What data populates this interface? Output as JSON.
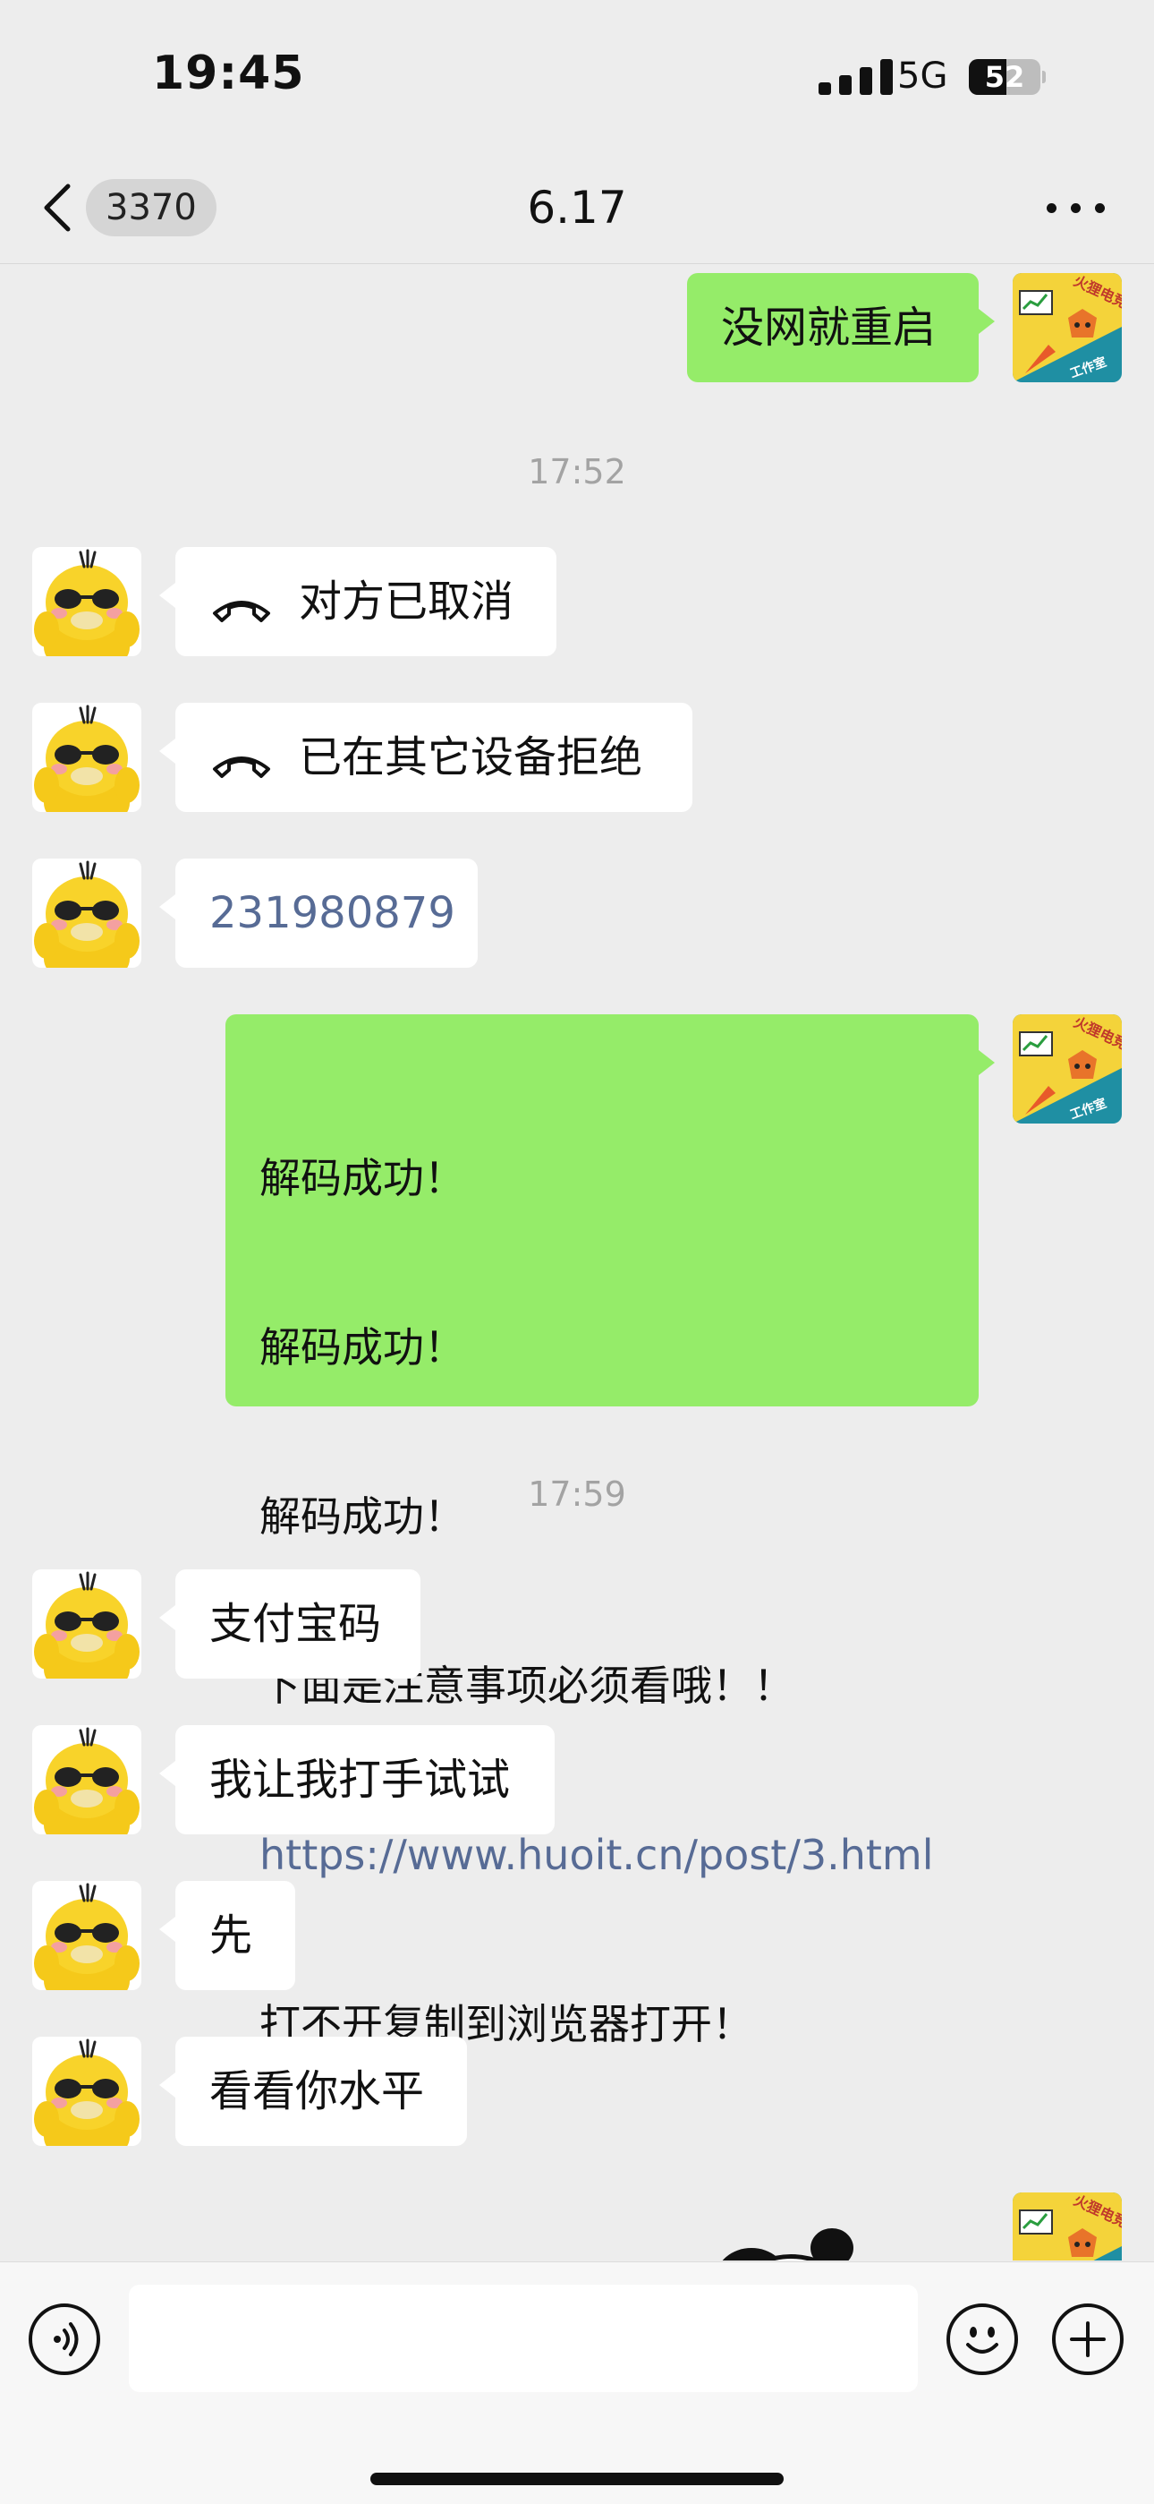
{
  "status_bar": {
    "time": "19:45",
    "network": "5G",
    "battery_level": "52",
    "battery_fraction": 0.52
  },
  "nav": {
    "back_icon": "chevron-left-icon",
    "unread_count": "3370",
    "title": "6.17",
    "more_icon": "more-dots-icon"
  },
  "chat": {
    "timestamps": [
      "17:52",
      "17:59"
    ],
    "messages": [
      {
        "from": "me",
        "text": "没网就重启"
      },
      {
        "from": "other",
        "type": "call",
        "icon": "phone-hangup-icon",
        "text": "对方已取消"
      },
      {
        "from": "other",
        "type": "call",
        "icon": "phone-hangup-icon",
        "text": "已在其它设备拒绝"
      },
      {
        "from": "other",
        "type": "link-number",
        "text": "231980879"
      },
      {
        "from": "me",
        "lines": [
          " 解码成功！",
          " 解码成功！",
          " 解码成功！",
          "下面是注意事项必须看哦！！",
          "https://www.huoit.cn/post/3.html",
          "打不开复制到浏览器打开！"
        ]
      },
      {
        "from": "other",
        "text": "支付宝码"
      },
      {
        "from": "other",
        "text": "我让我打手试试"
      },
      {
        "from": "other",
        "text": "先"
      },
      {
        "from": "other",
        "text": "看看你水平"
      }
    ],
    "my_avatar_text": "火狸电竞",
    "my_avatar_subtext": "工作室"
  },
  "input_bar": {
    "voice_icon": "voice-icon",
    "emoji_icon": "emoji-icon",
    "plus_icon": "plus-icon",
    "placeholder": ""
  },
  "colors": {
    "background": "#ededed",
    "bubble_out": "#95ec69",
    "bubble_in": "#ffffff",
    "link": "#576b95",
    "timestamp": "#a3a3a3"
  }
}
